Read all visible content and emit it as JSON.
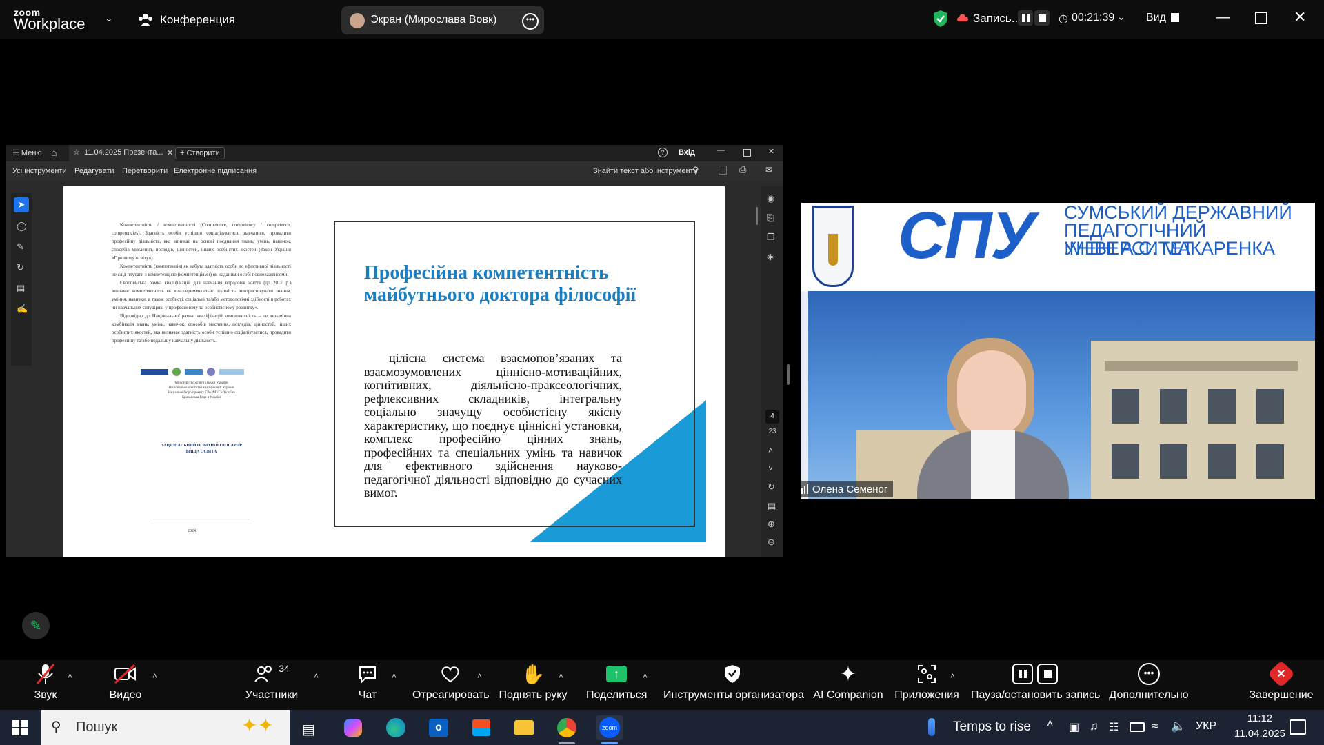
{
  "titlebar": {
    "logo_line1": "zoom",
    "logo_line2": "Workplace",
    "conference_label": "Конференция",
    "screen_label": "Экран (Мирослава Вовк)",
    "record_label": "Запись...",
    "timer": "00:21:39",
    "view_label": "Вид"
  },
  "doc": {
    "menu_label": "Меню",
    "tab_title": "11.04.2025 Презента...",
    "create_label": "Створити",
    "login_label": "Вхід",
    "tools": [
      "Усі інструменти",
      "Редагувати",
      "Перетворити",
      "Електронне підписання"
    ],
    "search_label": "Знайти текст або інструменти",
    "page_current": "4",
    "page_total": "23",
    "left_page_paragraphs": [
      "Компетентність / компетентності (Competence, competency / competence, competencies). Здатність особи успішно соціалізуватися, навчатися, провадити професійну діяльність, яка виникає на основі поєднання знань, умінь, навичок, способів мислення, поглядів, цінностей, інших особистих якостей (Закон України «Про вищу освіту»).",
      "Компетентність (компетенція) як набута здатність особи до ефективної діяльності не слід плутати з компетенцією (компетенціями) як наданими особі повноваженнями.",
      "Європейська рамка кваліфікацій для навчання впродовж життя (до 2017 р.) визначає компетентність як «експериментально здатність використовувати знання, уміння, навички, а також особисті, соціальні та/або методологічні здібності в роботах чи навчальних ситуаціях, у професійному та особистісному розвитку».",
      "Відповідно до Національної рамки кваліфікацій компетентність – це динамічна комбінація знань, умінь, навичок, способів мислення, поглядів, цінностей, інших особистих якостей, яка визначає здатність особи успішно соціалізуватися, провадити професійну та/або подальшу навчальну діяльність."
    ],
    "left_page_ministry": "Міністерство освіти і науки України\nНаціональне агентство кваліфікацій України\nНаціальне бюро проекту ЄРАЗМУС+ Україна\nБританська Рада в Україні",
    "left_page_footer_title": "НАЦІОНАЛЬНИЙ ОСВІТНІЙ ГЛОСАРІЙ:\nВИЩА ОСВІТА",
    "left_page_year": "2024",
    "slide_title": "Професійна компетентність майбутнього доктора філософії",
    "slide_body": "цілісна система взаємопов’язаних та взаємозумовлених ціннісно-мотиваційних, когнітивних, діяльнісно-праксеологічних, рефлексивних складників, інтегральну соціально значущу особистісну якісну характеристику, що поєднує ціннісні установки, комплекс професійно цінних знань, професійних та спеціальних умінь та навичок для ефективного здійснення науково-педагогічної діяльності відповідно до сучасних вимог."
  },
  "video": {
    "logo_text": "СПУ",
    "university_line1": "СУМСЬКИЙ ДЕРЖАВНИЙ",
    "university_line2": "ПЕДАГОГІЧНИЙ УНІВЕРСИТЕТ",
    "university_line3": "ІМЕНІ А.С. МАКАРЕНКА",
    "participant_name": "Олена Семеног"
  },
  "toolbar": {
    "audio": "Звук",
    "video": "Видео",
    "participants": "Участники",
    "participants_count": "34",
    "chat": "Чат",
    "react": "Отреагировать",
    "raise_hand": "Поднять руку",
    "share": "Поделиться",
    "host_tools": "Инструменты организатора",
    "ai": "AI Companion",
    "apps": "Приложения",
    "pause_record": "Пауза/остановить запись",
    "more": "Дополнительно",
    "end": "Завершение"
  },
  "taskbar": {
    "search_placeholder": "Пошук",
    "weather": "Temps to rise",
    "lang": "УКР",
    "time": "11:12",
    "date": "11.04.2025"
  },
  "colors": {
    "slide_blue": "#1a7fc1",
    "slide_triangle": "#1a9ad6",
    "share_green": "#1ec26b",
    "end_red": "#e02828",
    "shield_green": "#22b35e"
  }
}
